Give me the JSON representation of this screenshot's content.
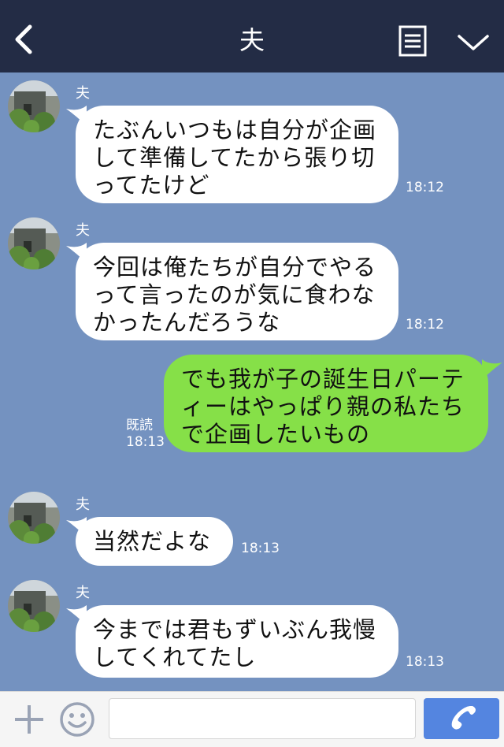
{
  "header": {
    "title": "夫"
  },
  "messages": [
    {
      "sender": "夫",
      "lines": [
        "たぶんいつもは自分が企画",
        "して準備してたから張り切",
        "ってたけど"
      ],
      "time": "18:12"
    },
    {
      "sender": "夫",
      "lines": [
        "今回は俺たちが自分でやる",
        "って言ったのが気に食わな",
        "かったんだろうな"
      ],
      "time": "18:12"
    },
    {
      "read": "既読",
      "lines": [
        "でも我が子の誕生日パーテ",
        "ィーはやっぱり親の私たち",
        "で企画したいもの"
      ],
      "time": "18:13"
    },
    {
      "sender": "夫",
      "lines": [
        "当然だよな"
      ],
      "time": "18:13"
    },
    {
      "sender": "夫",
      "lines": [
        "今までは君もずいぶん我慢",
        "してくれてたし"
      ],
      "time": "18:13"
    }
  ],
  "input": {
    "value": ""
  },
  "colors": {
    "header": "#232c45",
    "chat_bg": "#7492c0",
    "outgoing": "#86e048",
    "incoming": "#ffffff",
    "call": "#5485e0"
  },
  "icons": {
    "back": "back-icon",
    "menu": "menu-icon",
    "dropdown": "chevron-down-icon",
    "plus": "plus-icon",
    "emoji": "smile-icon",
    "call": "phone-icon"
  }
}
